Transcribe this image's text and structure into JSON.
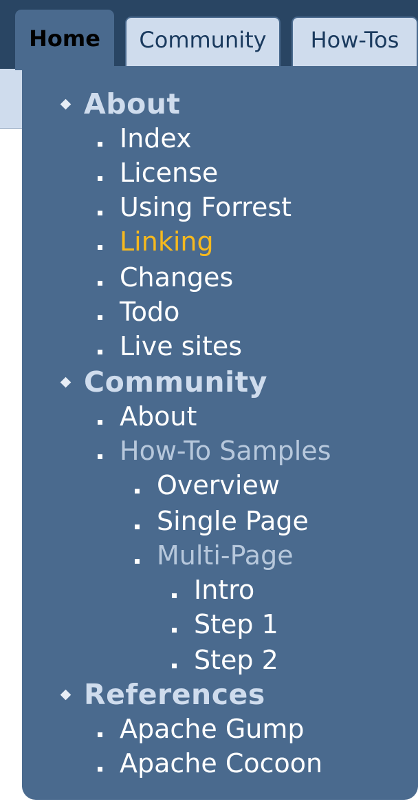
{
  "tabs": [
    {
      "label": "Home",
      "active": true
    },
    {
      "label": "Community",
      "active": false
    },
    {
      "label": "How-Tos",
      "active": false
    }
  ],
  "menu": {
    "groups": [
      {
        "label": "About",
        "items": [
          {
            "label": "Index"
          },
          {
            "label": "License"
          },
          {
            "label": "Using Forrest"
          },
          {
            "label": "Linking",
            "state": "selected"
          },
          {
            "label": "Changes"
          },
          {
            "label": "Todo"
          },
          {
            "label": "Live sites"
          }
        ]
      },
      {
        "label": "Community",
        "items": [
          {
            "label": "About"
          },
          {
            "label": "How-To Samples",
            "state": "muted",
            "items": [
              {
                "label": "Overview"
              },
              {
                "label": "Single Page"
              },
              {
                "label": "Multi-Page",
                "state": "muted",
                "items": [
                  {
                    "label": "Intro"
                  },
                  {
                    "label": "Step 1"
                  },
                  {
                    "label": "Step 2"
                  }
                ]
              }
            ]
          }
        ]
      },
      {
        "label": "References",
        "items": [
          {
            "label": "Apache Gump"
          },
          {
            "label": "Apache Cocoon"
          }
        ]
      }
    ]
  },
  "colors": {
    "header_background": "#294563",
    "panel_background": "#4a6a8e",
    "subbar_background": "#cfdced",
    "selected_link": "#f6b91e",
    "muted_link": "#b7c8dc"
  }
}
